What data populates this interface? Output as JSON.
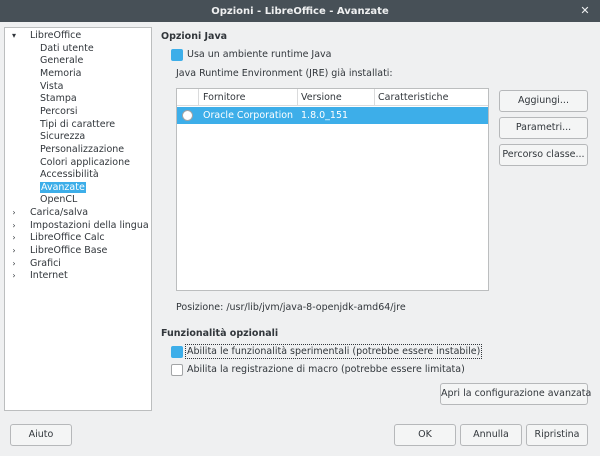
{
  "window": {
    "title": "Opzioni - LibreOffice - Avanzate",
    "close_icon": "close-icon"
  },
  "tree": {
    "items": [
      {
        "label": "LibreOffice",
        "level": 0,
        "expander": "▾"
      },
      {
        "label": "Dati utente",
        "level": 1
      },
      {
        "label": "Generale",
        "level": 1
      },
      {
        "label": "Memoria",
        "level": 1
      },
      {
        "label": "Vista",
        "level": 1
      },
      {
        "label": "Stampa",
        "level": 1
      },
      {
        "label": "Percorsi",
        "level": 1
      },
      {
        "label": "Tipi di carattere",
        "level": 1
      },
      {
        "label": "Sicurezza",
        "level": 1
      },
      {
        "label": "Personalizzazione",
        "level": 1
      },
      {
        "label": "Colori applicazione",
        "level": 1
      },
      {
        "label": "Accessibilità",
        "level": 1
      },
      {
        "label": "Avanzate",
        "level": 1,
        "selected": true
      },
      {
        "label": "OpenCL",
        "level": 1
      },
      {
        "label": "Carica/salva",
        "level": 0,
        "expander": "›"
      },
      {
        "label": "Impostazioni della lingua",
        "level": 0,
        "expander": "›"
      },
      {
        "label": "LibreOffice Calc",
        "level": 0,
        "expander": "›"
      },
      {
        "label": "LibreOffice Base",
        "level": 0,
        "expander": "›"
      },
      {
        "label": "Grafici",
        "level": 0,
        "expander": "›"
      },
      {
        "label": "Internet",
        "level": 0,
        "expander": "›"
      }
    ]
  },
  "java": {
    "section_title": "Opzioni Java",
    "use_jre_label": "Usa un ambiente runtime Java",
    "use_jre_checked": true,
    "installed_label": "Java Runtime Environment (JRE) già installati:",
    "columns": [
      "Fornitore",
      "Versione",
      "Caratteristiche"
    ],
    "rows": [
      {
        "vendor": "Oracle Corporation",
        "version": "1.8.0_151",
        "features": ""
      }
    ],
    "location_label": "Posizione: /usr/lib/jvm/java-8-openjdk-amd64/jre",
    "add_button": "Aggiungi...",
    "params_button": "Parametri...",
    "classpath_button": "Percorso classe..."
  },
  "optional": {
    "section_title": "Funzionalità opzionali",
    "experimental_label": "Abilita le funzionalità sperimentali (potrebbe essere instabile)",
    "experimental_checked": true,
    "macro_label": "Abilita la registrazione di macro (potrebbe essere limitata)",
    "macro_checked": false,
    "expert_button": "Apri la configurazione avanzata"
  },
  "footer": {
    "help_button": "Aiuto",
    "ok_button": "OK",
    "cancel_button": "Annulla",
    "reset_button": "Ripristina"
  },
  "colors": {
    "accent": "#3daee9",
    "titlebar": "#475057",
    "window_bg": "#eff0f1"
  }
}
